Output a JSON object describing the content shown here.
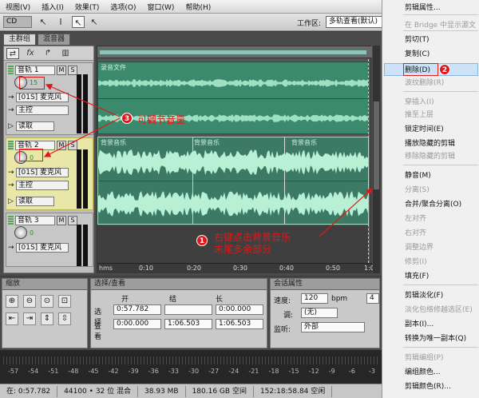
{
  "menubar": {
    "cd": "CD",
    "items": [
      "视图(V)",
      "插入(I)",
      "效果(T)",
      "选项(O)",
      "窗口(W)",
      "帮助(H)"
    ]
  },
  "toolbar": {
    "workspace_label": "工作区:",
    "workspace_value": "多轨查看(默认)"
  },
  "tabs": [
    "主群组",
    "混音器"
  ],
  "tracks": [
    {
      "name": "音轨 1",
      "volume": "15",
      "input": "[01S] 麦克风",
      "output": "主控",
      "mode": "读取"
    },
    {
      "name": "音轨 2",
      "volume": "0",
      "input": "[01S] 麦克风",
      "output": "主控",
      "mode": "读取"
    },
    {
      "name": "音轨 3",
      "volume": "0",
      "input": "[01S] 麦克风",
      "output": "",
      "mode": ""
    }
  ],
  "clips": {
    "track1": "录音文件",
    "track2": [
      "背景音乐",
      "背景音乐",
      "背景音乐"
    ]
  },
  "ruler": [
    "hms",
    "0:10",
    "0:20",
    "0:30",
    "0:40",
    "0:50",
    "1:00"
  ],
  "panels": {
    "zoom": {
      "title": "缩放"
    },
    "selection": {
      "title": "选择/查看",
      "headers": [
        "开始",
        "结束",
        "长度"
      ],
      "rows": [
        {
          "label": "选择",
          "start": "0:57.782",
          "end": "",
          "length": "0:00.000"
        },
        {
          "label": "查看",
          "start": "0:00.000",
          "end": "1:06.503",
          "length": "1:06.503"
        }
      ]
    },
    "session": {
      "title": "会话属性",
      "tempo_label": "速度:",
      "tempo": "120",
      "tempo_unit": "bpm",
      "key_label": "调:",
      "key": "(无)",
      "monitor_label": "监听:",
      "monitor": "外部",
      "beats": "4"
    }
  },
  "level_ticks": [
    "-57",
    "-54",
    "-51",
    "-48",
    "-45",
    "-42",
    "-39",
    "-36",
    "-33",
    "-30",
    "-27",
    "-24",
    "-21",
    "-18",
    "-15",
    "-12",
    "-9",
    "-6",
    "-3"
  ],
  "status": [
    "在: 0:57.782",
    "44100 • 32 位 混合",
    "38.93 MB",
    "180.16 GB 空间",
    "152:18:58.84 空闲"
  ],
  "context_menu": {
    "items": [
      {
        "label": "剪辑属性...",
        "disabled": false
      },
      {
        "label": "在 Bridge 中显示源文",
        "disabled": true
      },
      {
        "label": "剪切(T)",
        "disabled": false
      },
      {
        "label": "复制(C)",
        "disabled": false
      },
      {
        "label": "删除(D)",
        "disabled": false,
        "highlight": true
      },
      {
        "label": "波纹删除(R)",
        "disabled": true
      },
      {
        "label": "穿插入(I)",
        "disabled": true
      },
      {
        "label": "推至上层",
        "disabled": true
      },
      {
        "label": "锁定时间(E)",
        "disabled": false
      },
      {
        "label": "播放隐藏的剪辑",
        "disabled": false
      },
      {
        "label": "移除隐藏的剪辑",
        "disabled": true
      },
      {
        "label": "静音(M)",
        "disabled": false
      },
      {
        "label": "分离(S)",
        "disabled": true
      },
      {
        "label": "合并/聚合分离(O)",
        "disabled": false
      },
      {
        "label": "左对齐",
        "disabled": true
      },
      {
        "label": "右对齐",
        "disabled": true
      },
      {
        "label": "调整边界",
        "disabled": true
      },
      {
        "label": "修剪(I)",
        "disabled": true
      },
      {
        "label": "填充(F)",
        "disabled": false
      },
      {
        "label": "剪辑淡化(F)",
        "disabled": false
      },
      {
        "label": "淡化包络修越选区(E)",
        "disabled": true
      },
      {
        "label": "副本(I)...",
        "disabled": false
      },
      {
        "label": "转换为唯一副本(Q)",
        "disabled": false
      },
      {
        "label": "剪辑编组(P)",
        "disabled": true
      },
      {
        "label": "编组颜色...",
        "disabled": false
      },
      {
        "label": "剪辑颜色(R)...",
        "disabled": false
      }
    ]
  },
  "annotations": {
    "a1": {
      "num": "1",
      "text1": "右键点击背景音乐",
      "text2": "末尾多余部分"
    },
    "a2": {
      "num": "2"
    },
    "a3": {
      "num": "3",
      "text": "可调节音量"
    }
  },
  "colors": {
    "clip_green": "#3b8a6d",
    "highlight_red": "#e01818",
    "selected_track": "#e9e7a8"
  }
}
